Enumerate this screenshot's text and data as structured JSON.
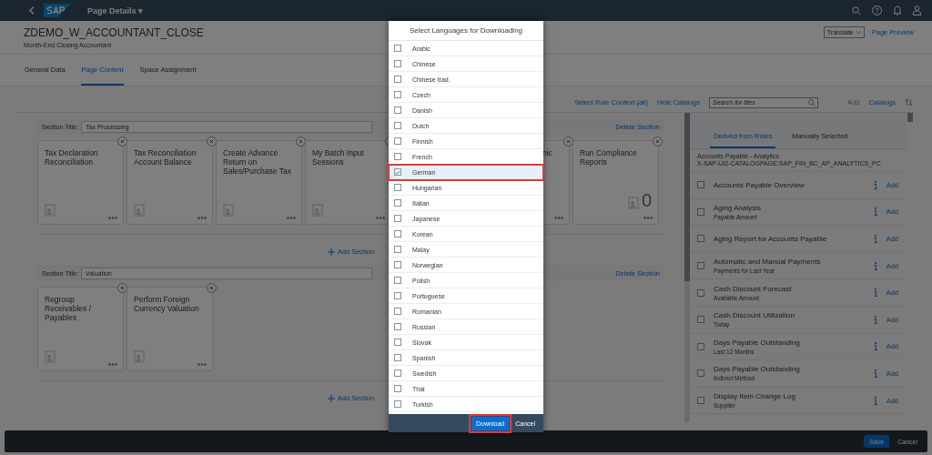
{
  "shell": {
    "title": "Page Details",
    "menu_caret": "▾"
  },
  "header": {
    "title": "ZDEMO_W_ACCOUNTANT_CLOSE",
    "subtitle": "Month-End Closing Accountant",
    "translate": "Translate",
    "preview": "Page Preview"
  },
  "tabs": [
    {
      "label": "General Data",
      "selected": false
    },
    {
      "label": "Page Content",
      "selected": true
    },
    {
      "label": "Space Assignment",
      "selected": false
    }
  ],
  "toolbar": {
    "role_context": "Select Role Context (all)",
    "hide_catalogs": "Hide Catalogs",
    "search_placeholder": "Search for tiles",
    "add": {
      "label": "Add",
      "disabled": true
    },
    "catalogs": "Catalogs"
  },
  "sections": [
    {
      "label": "Section Title:",
      "title": "Tax Processing",
      "delete": "Delete Section",
      "add_section": "Add Section",
      "tiles": [
        {
          "kind": "app",
          "title": "Tax Declaration Reconciliation"
        },
        {
          "kind": "app",
          "title": "Tax Reconciliation Account Balance"
        },
        {
          "kind": "app",
          "title": "Create Advance Return on Sales/Purchase Tax"
        },
        {
          "kind": "app",
          "title": "My Batch Input Sessions"
        },
        {
          "kind": "partial",
          "title": "nic"
        },
        {
          "kind": "kpi",
          "title": "Run Compliance Reports",
          "number": "0"
        }
      ]
    },
    {
      "label": "Section Title:",
      "title": "Valuation",
      "delete": "Delete Section",
      "add_section": "Add Section",
      "tiles": [
        {
          "kind": "app",
          "title": "Regroup Receivables / Payables"
        },
        {
          "kind": "app",
          "title": "Perform Foreign Currency Valuation"
        }
      ]
    }
  ],
  "catalog_panel": {
    "tabs": [
      {
        "label": "Derived from Roles",
        "selected": true
      },
      {
        "label": "Manually Selected",
        "selected": false
      }
    ],
    "catalog_name": "Accounts Payable - Analytics",
    "catalog_id": "X-SAP-UI2-CATALOGPAGE:SAP_FIN_BC_AP_ANALYTICS_PC",
    "rows": [
      {
        "title": "Accounts Payable Overview",
        "checked": false,
        "add": "Add"
      },
      {
        "title": "Aging Analysis",
        "subtitle": "Payable Amount",
        "checked": false,
        "add": "Add"
      },
      {
        "title": "Aging Report for Accounts Payable",
        "checked": false,
        "add": "Add"
      },
      {
        "title": "Automatic and Manual Payments",
        "subtitle": "Payments for Last Year",
        "checked": false,
        "add": "Add"
      },
      {
        "title": "Cash Discount Forecast",
        "subtitle": "Available Amount",
        "checked": false,
        "add": "Add"
      },
      {
        "title": "Cash Discount Utilization",
        "subtitle": "Today",
        "checked": false,
        "add": "Add"
      },
      {
        "title": "Days Payable Outstanding",
        "subtitle": "Last 12 Months",
        "checked": false,
        "add": "Add"
      },
      {
        "title": "Days Payable Outstanding",
        "subtitle": "Indirect Method",
        "checked": false,
        "add": "Add"
      },
      {
        "title": "Display Item Change Log",
        "subtitle": "Supplier",
        "checked": false,
        "add": "Add"
      }
    ]
  },
  "footer": {
    "save": "Save",
    "cancel": "Cancel"
  },
  "dialog": {
    "title": "Select Languages for Downloading",
    "languages": [
      {
        "label": "Arabic",
        "checked": false,
        "highlighted": false
      },
      {
        "label": "Chinese",
        "checked": false,
        "highlighted": false
      },
      {
        "label": "Chinese trad.",
        "checked": false,
        "highlighted": false
      },
      {
        "label": "Czech",
        "checked": false,
        "highlighted": false
      },
      {
        "label": "Danish",
        "checked": false,
        "highlighted": false
      },
      {
        "label": "Dutch",
        "checked": false,
        "highlighted": false
      },
      {
        "label": "Finnish",
        "checked": false,
        "highlighted": false
      },
      {
        "label": "French",
        "checked": false,
        "highlighted": false
      },
      {
        "label": "German",
        "checked": true,
        "highlighted": true
      },
      {
        "label": "Hungarian",
        "checked": false,
        "highlighted": false
      },
      {
        "label": "Italian",
        "checked": false,
        "highlighted": false
      },
      {
        "label": "Japanese",
        "checked": false,
        "highlighted": false
      },
      {
        "label": "Korean",
        "checked": false,
        "highlighted": false
      },
      {
        "label": "Malay",
        "checked": false,
        "highlighted": false
      },
      {
        "label": "Norwegian",
        "checked": false,
        "highlighted": false
      },
      {
        "label": "Polish",
        "checked": false,
        "highlighted": false
      },
      {
        "label": "Portuguese",
        "checked": false,
        "highlighted": false
      },
      {
        "label": "Romanian",
        "checked": false,
        "highlighted": false
      },
      {
        "label": "Russian",
        "checked": false,
        "highlighted": false
      },
      {
        "label": "Slovak",
        "checked": false,
        "highlighted": false
      },
      {
        "label": "Spanish",
        "checked": false,
        "highlighted": false
      },
      {
        "label": "Swedish",
        "checked": false,
        "highlighted": false
      },
      {
        "label": "Thai",
        "checked": false,
        "highlighted": false
      },
      {
        "label": "Turkish",
        "checked": false,
        "highlighted": false
      }
    ],
    "download": {
      "label": "Download",
      "highlighted": true
    },
    "cancel": "Cancel"
  }
}
